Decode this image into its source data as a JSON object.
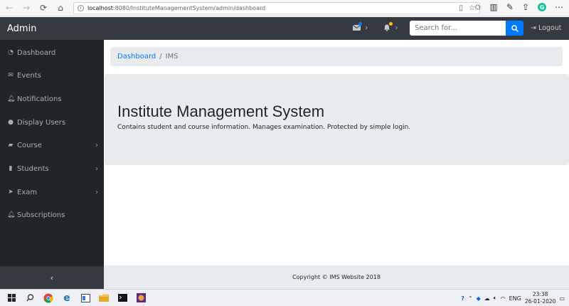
{
  "browser": {
    "url_host": "localhost",
    "url_rest": ":8080/InstituteManagementSystem/admin/dashboard"
  },
  "navbar": {
    "brand": "Admin",
    "search_placeholder": "Search for...",
    "logout_label": "Logout",
    "message_dot_color": "#007bff",
    "alert_dot_color": "#ffc107"
  },
  "sidebar": {
    "items": [
      {
        "label": "Dashboard",
        "icon": "dashboard-icon",
        "has_submenu": false
      },
      {
        "label": "Events",
        "icon": "envelope-icon",
        "has_submenu": false
      },
      {
        "label": "Notifications",
        "icon": "bell-icon",
        "has_submenu": false
      },
      {
        "label": "Display Users",
        "icon": "user-icon",
        "has_submenu": false
      },
      {
        "label": "Course",
        "icon": "book-icon",
        "has_submenu": true
      },
      {
        "label": "Students",
        "icon": "file-icon",
        "has_submenu": true
      },
      {
        "label": "Exam",
        "icon": "paper-plane-icon",
        "has_submenu": true
      },
      {
        "label": "Subscriptions",
        "icon": "bell-icon",
        "has_submenu": false
      }
    ],
    "toggle_glyph": "‹"
  },
  "breadcrumb": {
    "link": "Dashboard",
    "separator": "/",
    "current": "IMS"
  },
  "jumbotron": {
    "title": "Institute Management System",
    "lead": "Contains student and course information. Manages examination. Protected by simple login."
  },
  "footer": {
    "text": "Copyright © IMS Website 2018"
  },
  "taskbar": {
    "language": "ENG",
    "time": "23:38",
    "date": "26-01-2020"
  },
  "colors": {
    "navbar_bg": "#343a40",
    "sidebar_bg": "#212529",
    "primary": "#007bff",
    "content_bg": "#e9ecef"
  }
}
